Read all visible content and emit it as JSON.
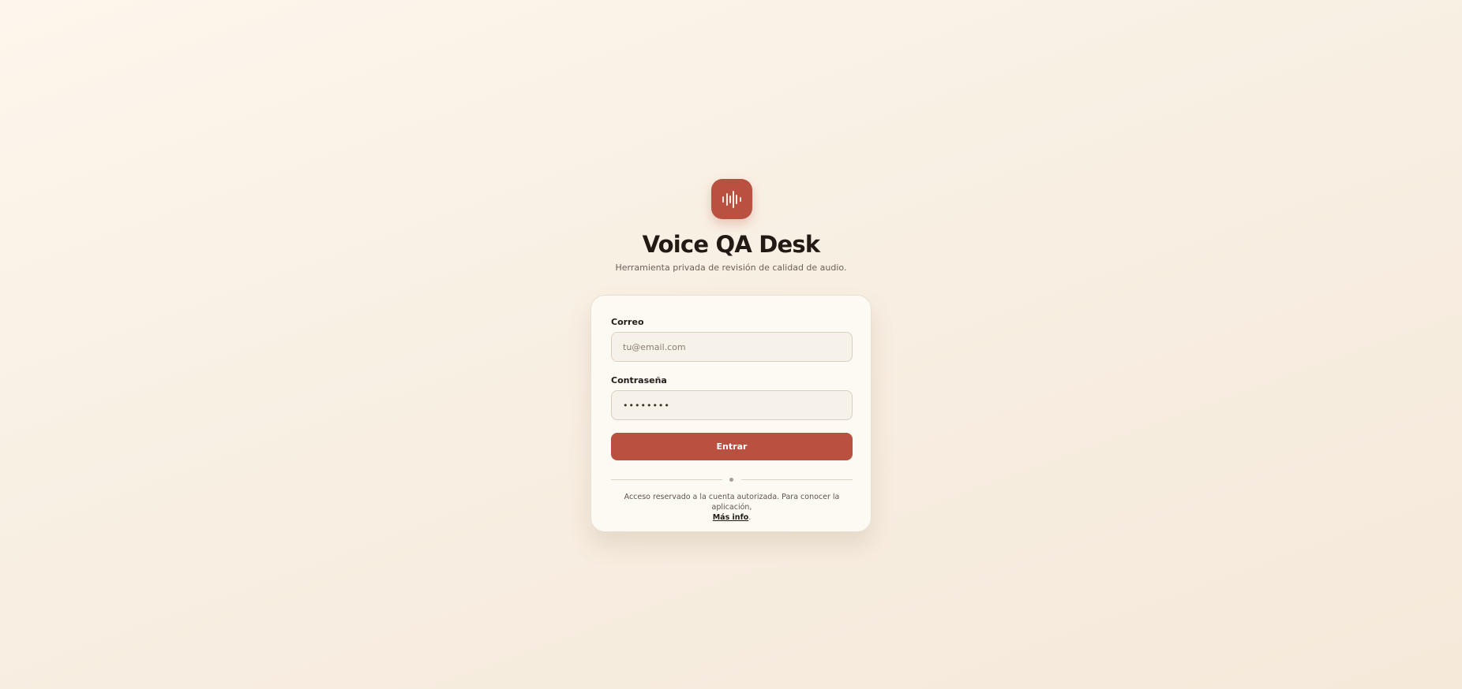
{
  "app": {
    "title": "Voice QA Desk",
    "subtitle": "Herramienta privada de revisión de calidad de audio.",
    "logo_icon": "audio-waveform-icon"
  },
  "form": {
    "email_label": "Correo",
    "email_placeholder": "tu@email.com",
    "email_value": "",
    "password_label": "Contraseña",
    "password_value": "••••••••",
    "submit_label": "Entrar"
  },
  "footer": {
    "notice_text": "Acceso reservado a la cuenta autorizada. Para conocer la aplicación,",
    "more_info_link": "Más info",
    "trailing_period": "."
  },
  "colors": {
    "accent": "#b95040",
    "background": "#f7ede0",
    "card": "#fdfaf4",
    "text": "#221a15"
  }
}
